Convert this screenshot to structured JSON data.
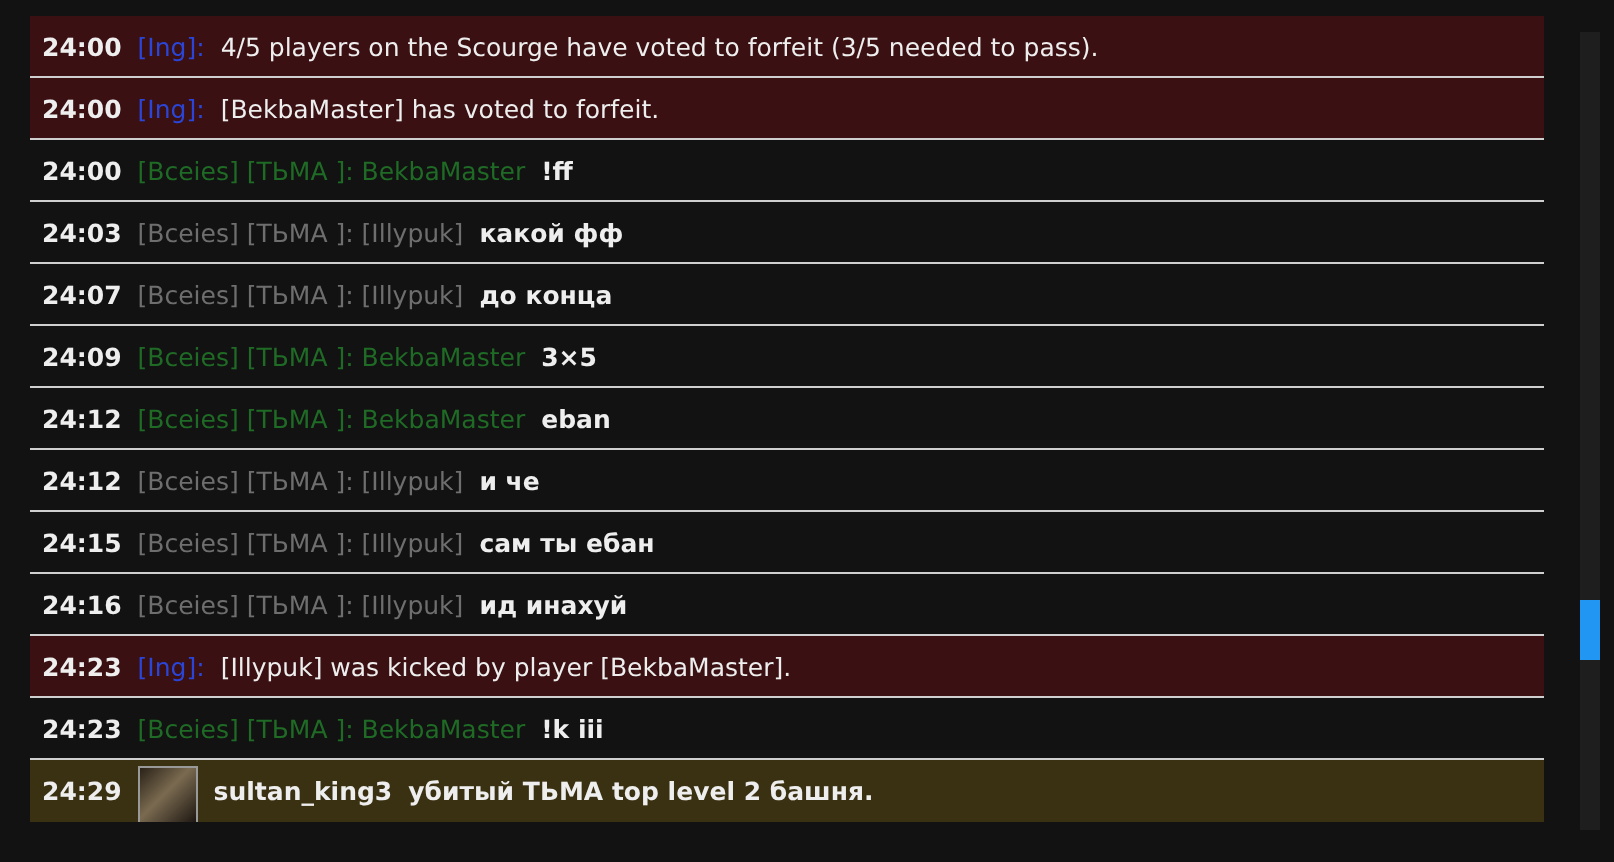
{
  "messages": [
    {
      "kind": "system",
      "time": "24:00",
      "channel": "[Ing]:",
      "text": "4/5 players on the Scourge have voted to forfeit (3/5 needed to pass)."
    },
    {
      "kind": "system",
      "time": "24:00",
      "channel": "[Ing]:",
      "text": "[BekbaMaster] has voted to forfeit."
    },
    {
      "kind": "chat",
      "time": "24:00",
      "sender": "[Bceies] [ТЬМА ]: BekbaMaster",
      "color": "#1f6b26",
      "text": "!ff"
    },
    {
      "kind": "chat",
      "time": "24:03",
      "sender": "[Bceies] [ТЬМА ]: [Illypuk]",
      "color": "#6e6e6e",
      "text": "какой фф"
    },
    {
      "kind": "chat",
      "time": "24:07",
      "sender": "[Bceies] [ТЬМА ]: [Illypuk]",
      "color": "#6e6e6e",
      "text": "до конца"
    },
    {
      "kind": "chat",
      "time": "24:09",
      "sender": "[Bceies] [ТЬМА ]: BekbaMaster",
      "color": "#1f6b26",
      "text": "3×5"
    },
    {
      "kind": "chat",
      "time": "24:12",
      "sender": "[Bceies] [ТЬМА ]: BekbaMaster",
      "color": "#1f6b26",
      "text": "eban"
    },
    {
      "kind": "chat",
      "time": "24:12",
      "sender": "[Bceies] [ТЬМА ]: [Illypuk]",
      "color": "#6e6e6e",
      "text": "и че"
    },
    {
      "kind": "chat",
      "time": "24:15",
      "sender": "[Bceies] [ТЬМА ]: [Illypuk]",
      "color": "#6e6e6e",
      "text": "сам ты ебан"
    },
    {
      "kind": "chat",
      "time": "24:16",
      "sender": "[Bceies] [ТЬМА ]: [Illypuk]",
      "color": "#6e6e6e",
      "text": "ид инахуй"
    },
    {
      "kind": "system",
      "time": "24:23",
      "channel": "[Ing]:",
      "text": "[Illypuk] was kicked by player [BekbaMaster]."
    },
    {
      "kind": "chat",
      "time": "24:23",
      "sender": "[Bceies] [ТЬМА ]: BekbaMaster",
      "color": "#1f6b26",
      "text": "!k iii"
    },
    {
      "kind": "kill",
      "time": "24:29",
      "sender": "sultan_king3",
      "text": "убитый ТЬМА top level 2 башня."
    }
  ]
}
